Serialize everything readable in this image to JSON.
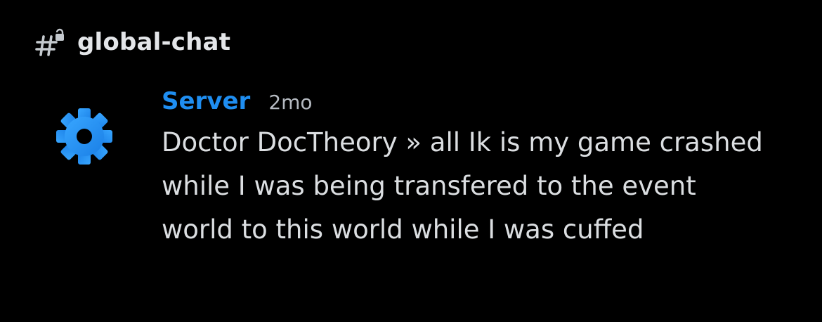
{
  "channel": {
    "name": "global-chat",
    "icon": "hash-lock-icon"
  },
  "message": {
    "author": "Server",
    "author_color": "#1f8ef1",
    "avatar_icon": "gear-icon",
    "avatar_color": "#1f8ef1",
    "timestamp": "2mo",
    "content": "Doctor DocTheory » all Ik is my game crashed while I was being transfered to the event world to this world while I was cuffed"
  }
}
